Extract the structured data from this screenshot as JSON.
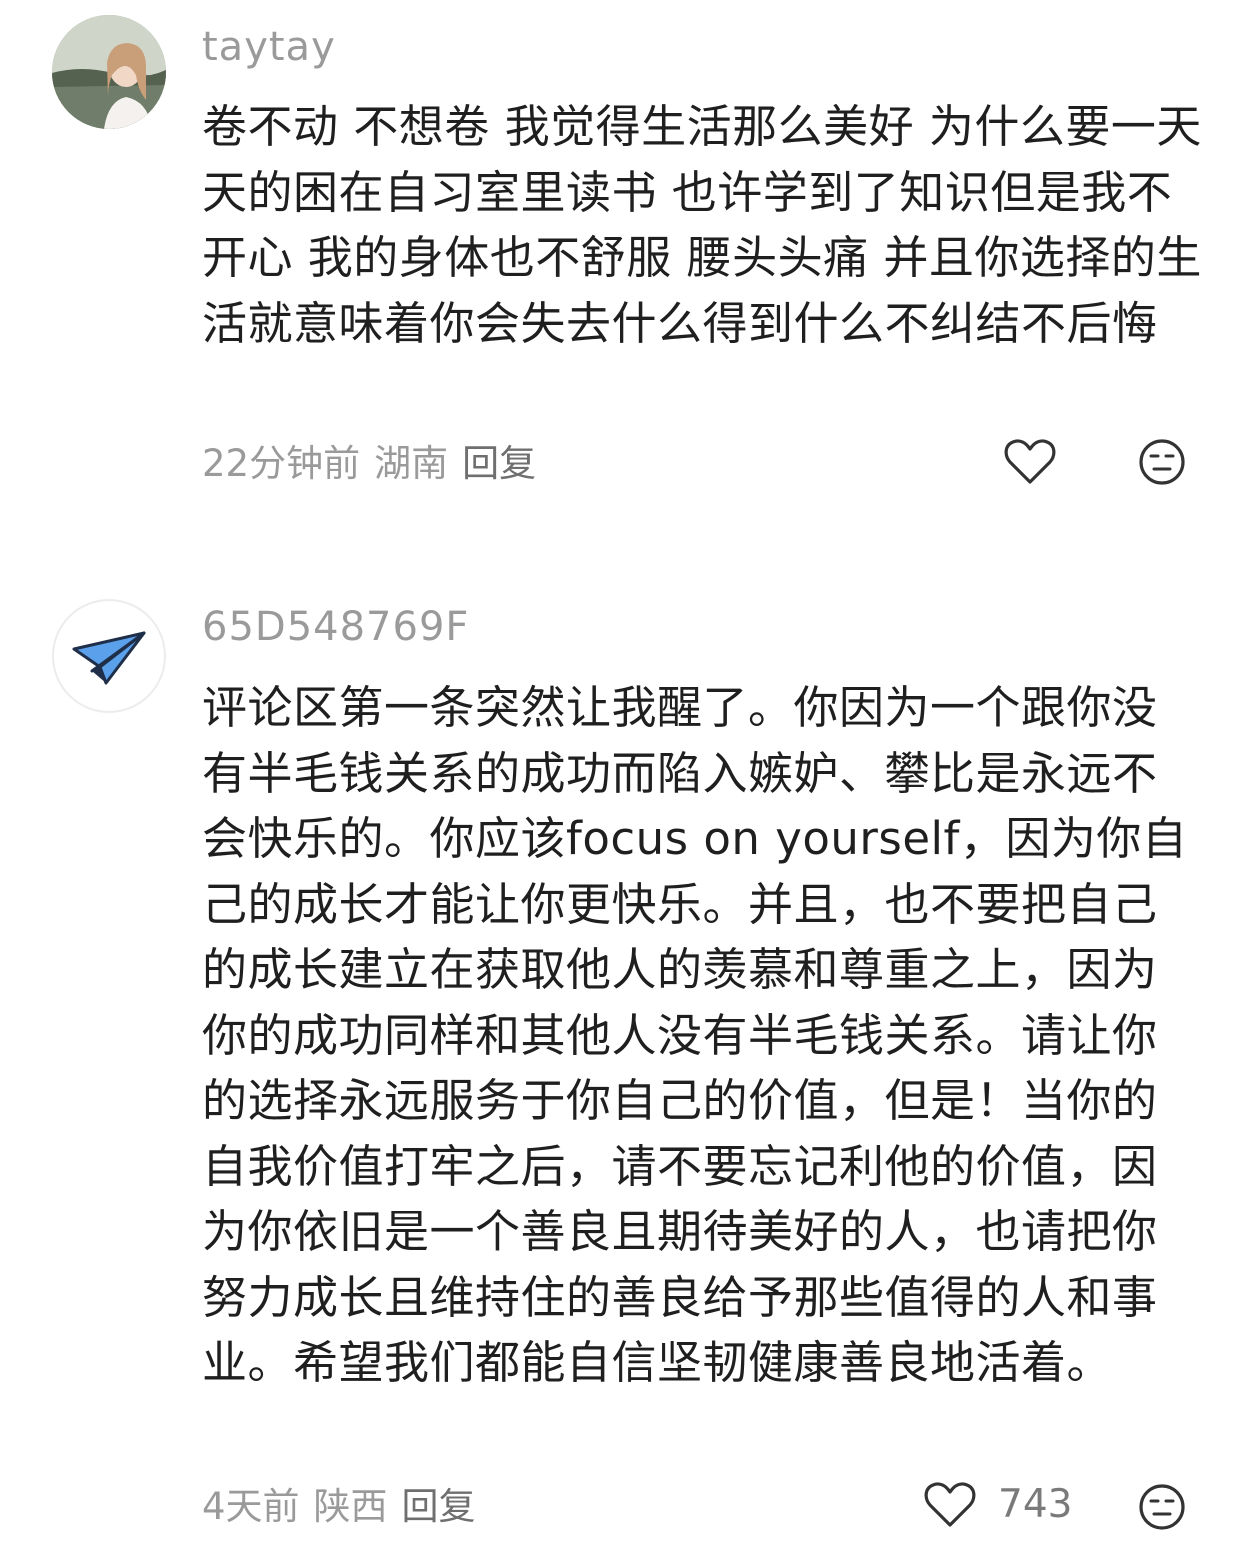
{
  "comments": [
    {
      "username": "taytay",
      "text": "卷不动 不想卷 我觉得生活那么美好 为什么要一天天的困在自习室里读书 也许学到了知识但是我不开心 我的身体也不舒服 腰头头痛  并且你选择的生活就意味着你会失去什么得到什么不纠结不后悔",
      "time": "22分钟前",
      "location": "湖南",
      "reply_label": "回复",
      "likes": "",
      "avatar_icon": "portrait-photo-avatar"
    },
    {
      "username": "65D548769F",
      "text": "评论区第一条突然让我醒了。你因为一个跟你没有半毛钱关系的成功而陷入嫉妒、攀比是永远不会快乐的。你应该focus on yourself，因为你自己的成长才能让你更快乐。并且，也不要把自己的成长建立在获取他人的羡慕和尊重之上，因为你的成功同样和其他人没有半毛钱关系。请让你的选择永远服务于你自己的价值，但是！当你的自我价值打牢之后，请不要忘记利他的价值，因为你依旧是一个善良且期待美好的人，也请把你努力成长且维持住的善良给予那些值得的人和事业。希望我们都能自信坚韧健康善良地活着。",
      "time": "4天前",
      "location": "陕西",
      "reply_label": "回复",
      "likes": "743",
      "avatar_icon": "paper-plane-avatar"
    }
  ],
  "icons": {
    "like": "heart-outline-icon",
    "dislike": "meh-face-icon"
  },
  "colors": {
    "meta_text": "#9a9a9a",
    "icon_stroke": "#333333",
    "plane_blue": "#4a90e2"
  }
}
